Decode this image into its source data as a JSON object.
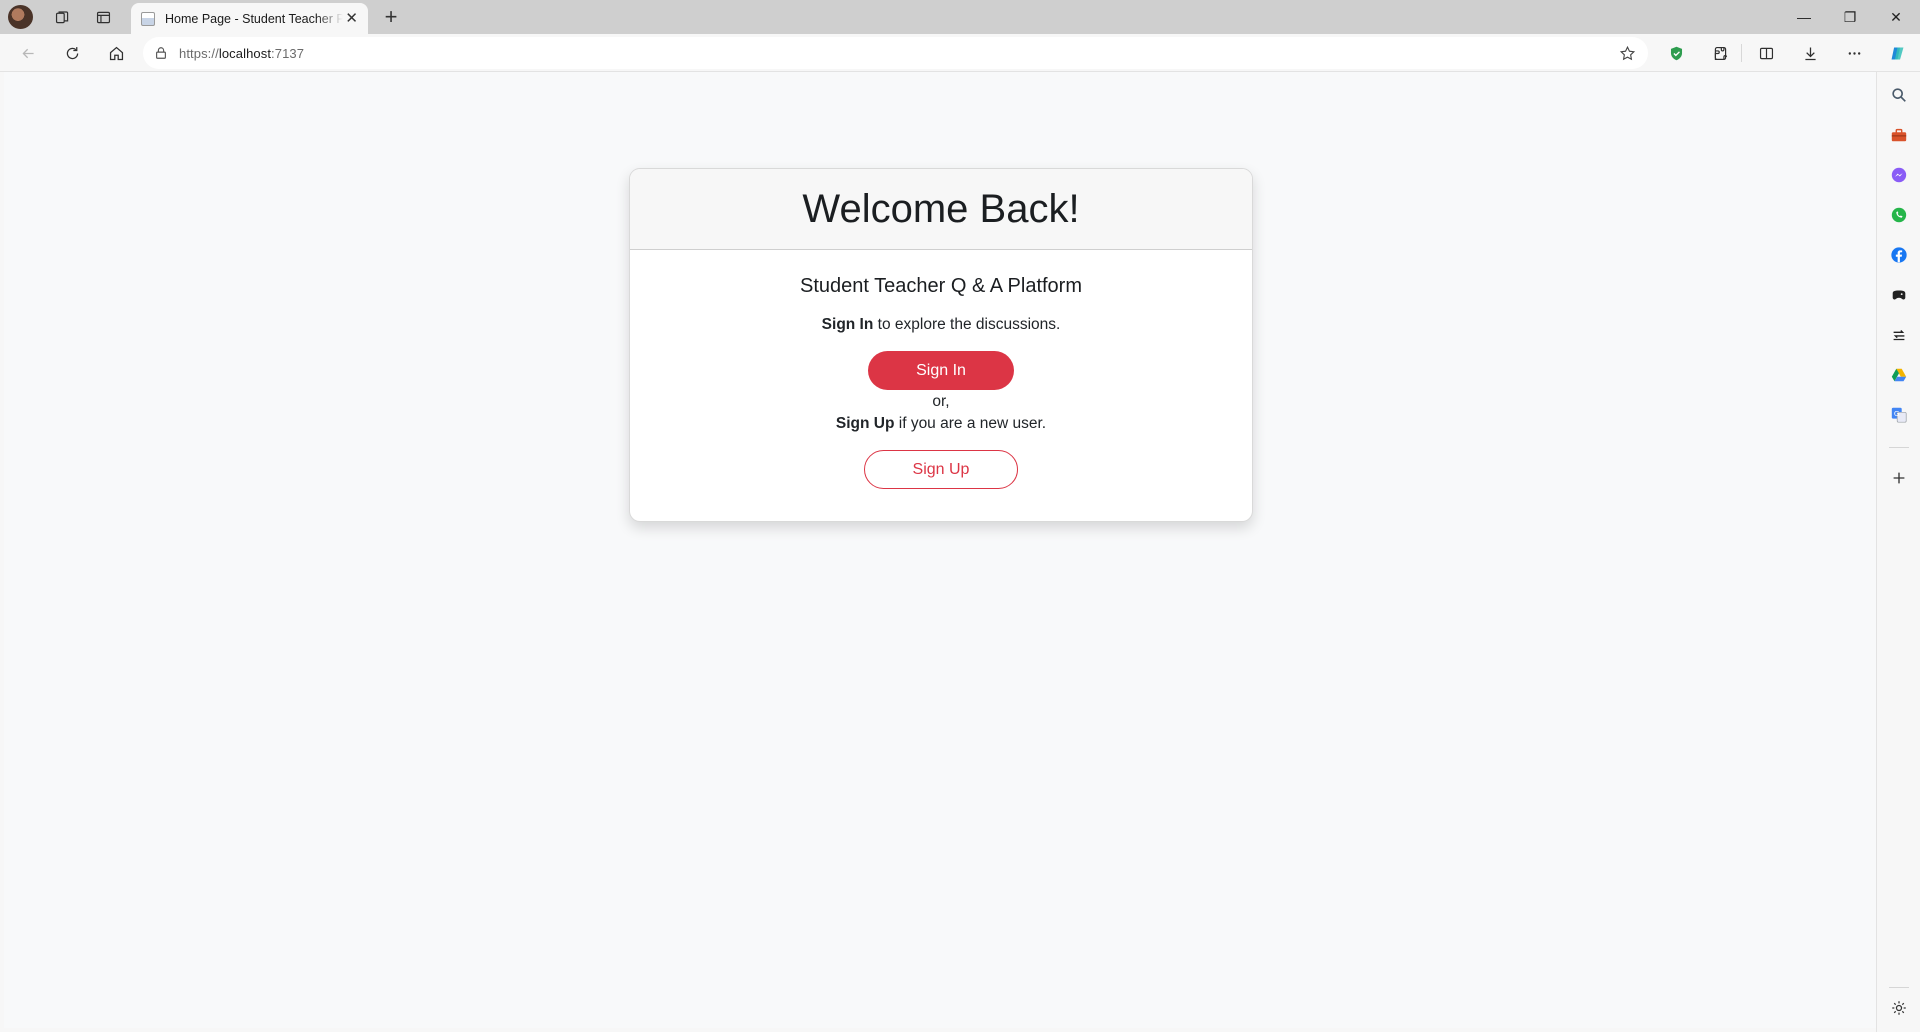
{
  "browser": {
    "tab": {
      "title": "Home Page - Student Teacher Platform",
      "close_glyph": "✕"
    },
    "new_tab_glyph": "+",
    "address": {
      "scheme": "https://",
      "host": "localhost",
      "port": ":7137"
    },
    "window_controls": {
      "minimize": "—",
      "restore": "❐",
      "close": "✕"
    }
  },
  "page": {
    "heading": "Welcome Back!",
    "subtitle": "Student Teacher Q & A Platform",
    "signin_prompt": {
      "bold": "Sign In",
      "rest": " to explore the discussions."
    },
    "signin_button": "Sign In",
    "or_text": "or,",
    "signup_prompt": {
      "bold": "Sign Up",
      "rest": " if you are a new user."
    },
    "signup_button": "Sign Up"
  },
  "colors": {
    "accent": "#dc3545",
    "card_header_bg": "#f7f7f7",
    "page_bg": "#f8f9fa"
  },
  "icons": {
    "tabstrip": [
      "profile-avatar",
      "workspaces-icon",
      "vertical-tabs-icon"
    ],
    "toolbar": [
      "back-icon",
      "refresh-icon",
      "home-icon",
      "lock-icon",
      "favorite-star-icon",
      "shield-extension-icon",
      "extensions-icon",
      "split-screen-icon",
      "downloads-icon",
      "more-icon",
      "copilot-icon"
    ],
    "sidebar": [
      "search-icon",
      "tools-icon",
      "messenger-icon",
      "whatsapp-icon",
      "facebook-icon",
      "game-icon",
      "drive-sync-icon",
      "google-drive-icon",
      "translate-icon",
      "add-icon",
      "settings-icon"
    ]
  }
}
